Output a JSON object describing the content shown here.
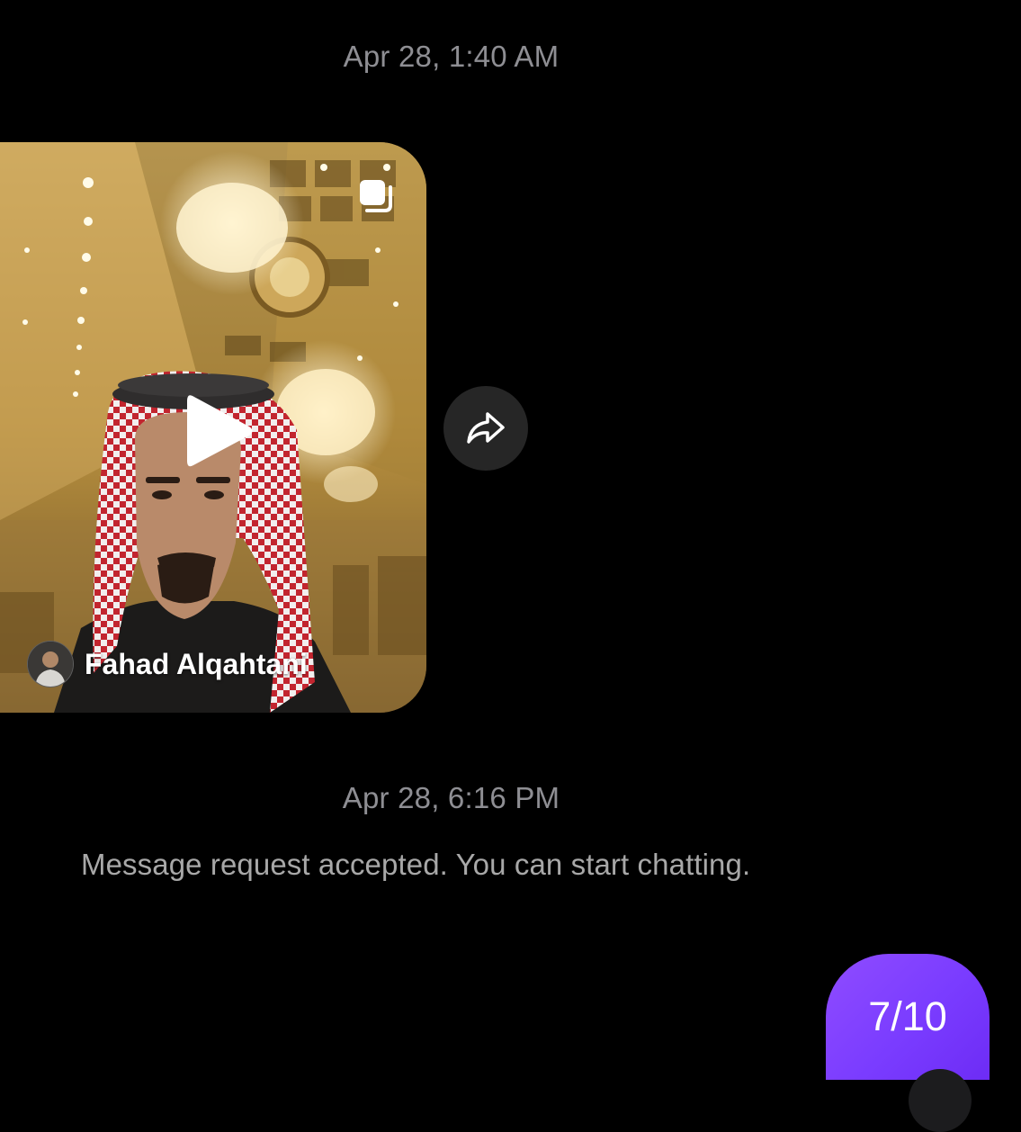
{
  "thread": {
    "timestamp_1": "Apr 28, 1:40 AM",
    "timestamp_2": "Apr 28, 6:16 PM",
    "system_message": "Message request accepted. You can start chatting."
  },
  "reel": {
    "author_name": "Fahad Alqahtani",
    "play_icon": "play-icon",
    "badge_icon": "reel-multiple-icon"
  },
  "share": {
    "icon": "share-arrow-icon"
  },
  "sent_message": {
    "text": "7/10",
    "bubble_color": "#7a3cff"
  },
  "colors": {
    "background": "#000000",
    "timestamp": "#8e8e93",
    "system_text": "#a8a8a8",
    "share_button_bg": "#262626"
  }
}
